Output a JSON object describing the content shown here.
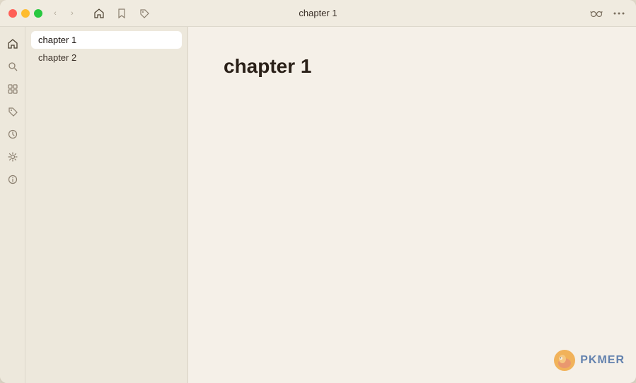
{
  "window": {
    "title": "chapter 1"
  },
  "titlebar": {
    "traffic_lights": {
      "close_label": "close",
      "minimize_label": "minimize",
      "maximize_label": "maximize"
    },
    "nav_back": "‹",
    "nav_forward": "›",
    "icons": [
      {
        "name": "home",
        "symbol": "⌂",
        "active": true
      },
      {
        "name": "bookmark",
        "symbol": "🔖",
        "active": false
      },
      {
        "name": "tag",
        "symbol": "🏷",
        "active": false
      }
    ],
    "right_icons": [
      {
        "name": "glasses",
        "symbol": "👓"
      },
      {
        "name": "more",
        "symbol": "···"
      }
    ]
  },
  "sidebar": {
    "items": [
      {
        "id": "chapter-1",
        "label": "chapter 1",
        "selected": true
      },
      {
        "id": "chapter-2",
        "label": "chapter 2",
        "selected": false
      }
    ]
  },
  "sidebar_icons": [
    {
      "name": "home",
      "symbol": "⌂",
      "active": true
    },
    {
      "name": "search",
      "symbol": "🔍",
      "active": false
    },
    {
      "name": "grid",
      "symbol": "⊞",
      "active": false
    },
    {
      "name": "tag",
      "symbol": "◈",
      "active": false
    },
    {
      "name": "clock",
      "symbol": "◉",
      "active": false
    },
    {
      "name": "settings",
      "symbol": "⚙",
      "active": false
    },
    {
      "name": "info",
      "symbol": "ℹ",
      "active": false
    }
  ],
  "editor": {
    "heading": "chapter 1"
  },
  "pkmer": {
    "text": "PKMER"
  }
}
